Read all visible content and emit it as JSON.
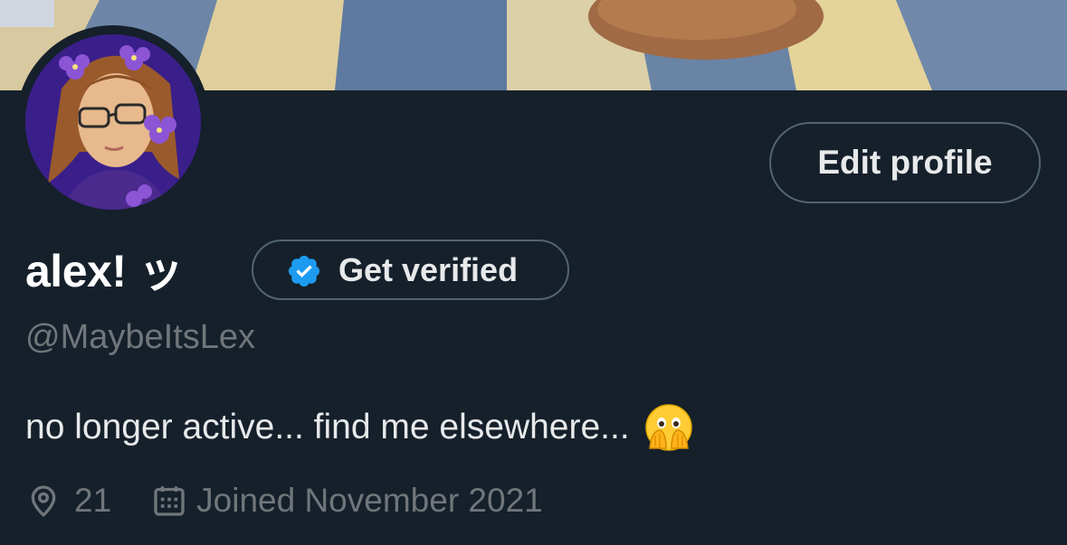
{
  "profile": {
    "display_name": "alex! ッ",
    "handle": "@MaybeItsLex",
    "bio": "no longer active... find me elsewhere...",
    "bio_emoji": "face-with-open-eyes-and-hand-over-mouth",
    "location": "21",
    "joined": "Joined November 2021"
  },
  "actions": {
    "edit_profile": "Edit profile",
    "get_verified": "Get verified"
  },
  "colors": {
    "background": "#15202b",
    "text_primary": "#e7e9ea",
    "text_secondary": "#71767b",
    "border": "#536471",
    "verified_badge": "#1d9bf0"
  },
  "icons": {
    "verify": "verified-badge-icon",
    "location": "location-pin-icon",
    "calendar": "calendar-icon"
  }
}
